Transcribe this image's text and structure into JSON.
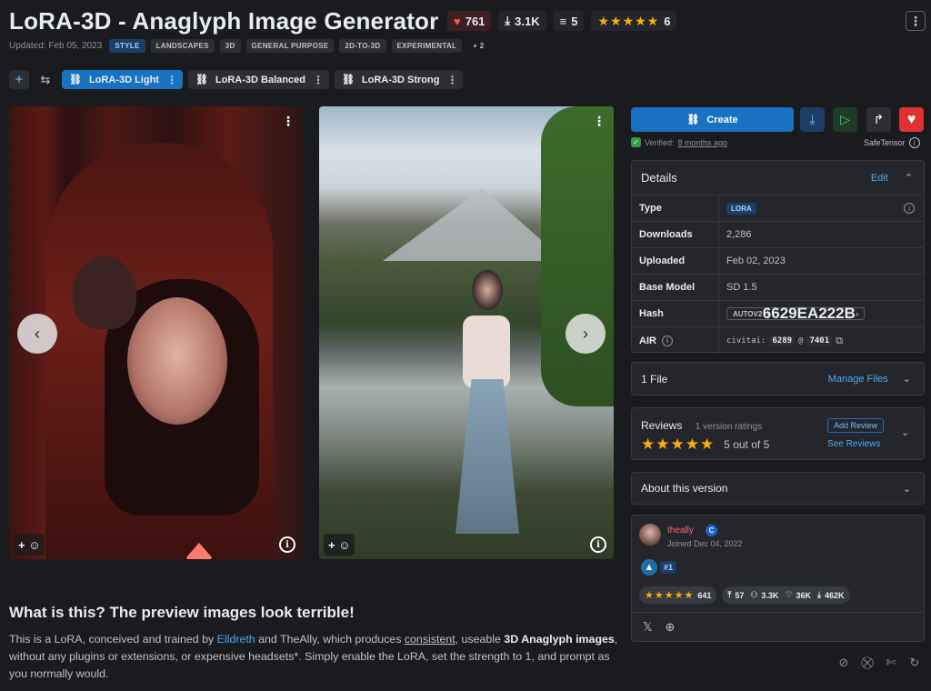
{
  "header": {
    "title": "LoRA-3D - Anaglyph Image Generator",
    "likes": "761",
    "downloads": "3.1K",
    "comments": "5",
    "rating_count": "6",
    "rating_stars": "★★★★★"
  },
  "meta": {
    "updated": "Updated: Feb 05, 2023",
    "tags": [
      "STYLE",
      "LANDSCAPES",
      "3D",
      "GENERAL PURPOSE",
      "2D-TO-3D",
      "EXPERIMENTAL"
    ],
    "more_tags": "+ 2"
  },
  "versions": [
    {
      "label": "LoRA-3D Light",
      "active": true
    },
    {
      "label": "LoRA-3D Balanced",
      "active": false
    },
    {
      "label": "LoRA-3D Strong",
      "active": false
    }
  ],
  "icons": {
    "plus": "+",
    "swap": "⇆",
    "kebab": "⋮",
    "chevron_left": "‹",
    "chevron_right": "›",
    "react": "+ ☺",
    "info": "i",
    "link": "⛓",
    "download": "⤓",
    "play": "▷",
    "share": "↱",
    "heart": "♥",
    "check": "✓",
    "chevron_up": "⌃",
    "chevron_down": "⌄",
    "copy": "⧉",
    "twitter": "🐦",
    "globe": "⊕"
  },
  "actions": {
    "create_label": "Create",
    "verified_prefix": "Verified:",
    "verified_when": "8 months ago",
    "safetensor": "SafeTensor"
  },
  "details": {
    "heading": "Details",
    "edit": "Edit",
    "type_label": "Type",
    "type_value": "LORA",
    "downloads_label": "Downloads",
    "downloads_value": "2,286",
    "uploaded_label": "Uploaded",
    "uploaded_value": "Feb 02, 2023",
    "base_label": "Base Model",
    "base_value": "SD 1.5",
    "hash_label": "Hash",
    "hash_type": "AUTOV2",
    "hash_value": "6629EA222B",
    "air_label": "AIR",
    "air_prefix": "civitai:",
    "air_model": "6289",
    "air_at": "@",
    "air_version": "7401"
  },
  "files": {
    "label": "1 File",
    "manage": "Manage Files"
  },
  "reviews": {
    "title": "Reviews",
    "count": "1 version ratings",
    "stars": "★★★★★",
    "score": "5 out of 5",
    "add": "Add Review",
    "see": "See Reviews"
  },
  "about": {
    "label": "About this version"
  },
  "creator": {
    "name": "theally",
    "badge": "C",
    "joined": "Joined Dec 04, 2022",
    "rank": "#1",
    "stars": "★★★★★",
    "rating_count": "641",
    "uploads": "57",
    "followers": "3.3K",
    "likes": "36K",
    "downloads": "462K"
  },
  "article": {
    "heading": "What is this? The preview images look terrible!",
    "p1_a": "This is a LoRA, conceived and trained by ",
    "p1_link": "Elldreth",
    "p1_b": " and TheAlly, which produces ",
    "p1_u": "consistent",
    "p1_c": ", useable ",
    "p1_bold": "3D Anaglyph images",
    "p1_d": ", without any plugins or extensions, or expensive headsets*. Simply enable the LoRA, set the strength to 1, and prompt as you normally would."
  },
  "colors": {
    "background": "#1a1b1e",
    "accent": "#1971c2",
    "heart": "#fa5252",
    "play_green": "#2f9e44",
    "star": "#fab005"
  }
}
